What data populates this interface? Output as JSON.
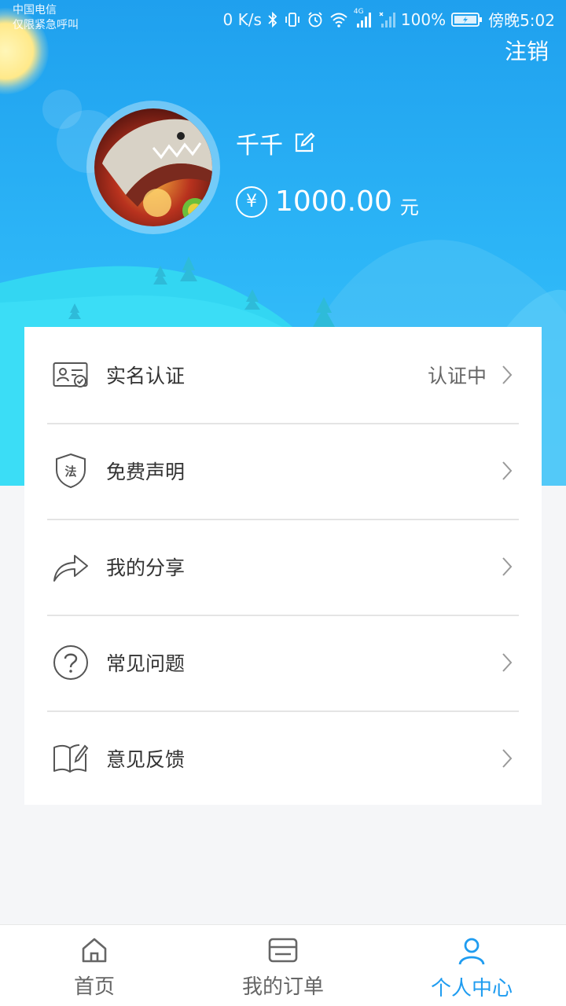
{
  "status_bar": {
    "carrier_line1": "中国电信",
    "carrier_line2": "仅限紧急呼叫",
    "net_speed": "0 K/s",
    "network_type": "4G",
    "battery": "100%",
    "time": "傍晚5:02"
  },
  "header": {
    "logout_label": "注销"
  },
  "profile": {
    "username": "千千",
    "currency_symbol": "¥",
    "balance": "1000.00",
    "balance_unit": "元"
  },
  "menu": {
    "items": [
      {
        "label": "实名认证",
        "status": "认证中",
        "icon": "id-card-icon"
      },
      {
        "label": "免费声明",
        "status": "",
        "icon": "law-shield-icon"
      },
      {
        "label": "我的分享",
        "status": "",
        "icon": "share-arrow-icon"
      },
      {
        "label": "常见问题",
        "status": "",
        "icon": "question-icon"
      },
      {
        "label": "意见反馈",
        "status": "",
        "icon": "feedback-book-icon"
      }
    ]
  },
  "tabbar": {
    "tabs": [
      {
        "label": "首页",
        "icon": "home-icon",
        "active": false
      },
      {
        "label": "我的订单",
        "icon": "order-card-icon",
        "active": false
      },
      {
        "label": "个人中心",
        "icon": "person-icon",
        "active": true
      }
    ]
  },
  "colors": {
    "accent": "#1f9cf0",
    "hero_top": "#1fa0ee",
    "hero_bottom": "#3fc6fb"
  }
}
